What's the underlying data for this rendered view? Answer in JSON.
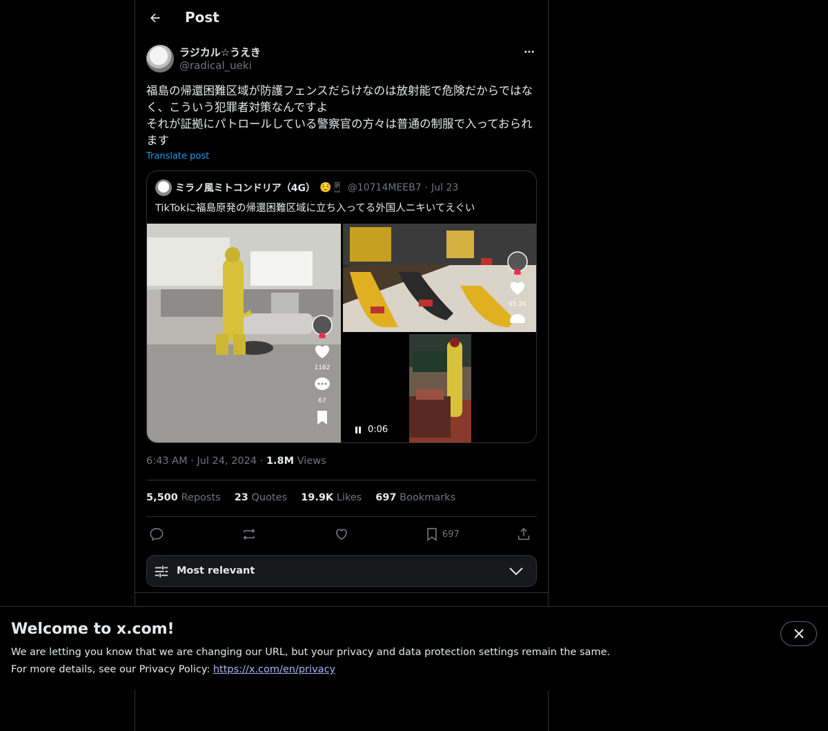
{
  "header": {
    "title": "Post"
  },
  "post": {
    "author_name": "ラジカル☆うえき",
    "author_handle": "@radical_ueki",
    "text": "福島の帰還困難区域が防護フェンスだらけなのは放射能で危険だからではなく、こういう犯罪者対策なんですよ\nそれが証拠にパトロールしている警察官の方々は普通の制服で入っておられます",
    "translate_label": "Translate post",
    "time": "6:43 AM",
    "date": "Jul 24, 2024",
    "views_count": "1.8M",
    "views_label": "Views"
  },
  "quote": {
    "author_name": "ミラノ風ミトコンドリア（4G）",
    "emoji": "☺️📱",
    "handle": "@10714MEEB7",
    "date": "Jul 23",
    "text": "TikTokに福島原発の帰還困難区域に立ち入ってる外国人ニキいてえぐい",
    "media": {
      "video_time": "0:06",
      "likes_1": "1162",
      "comments_1": "67",
      "likes_2": "65.2K"
    }
  },
  "stats": {
    "reposts_count": "5,500",
    "reposts_label": "Reposts",
    "quotes_count": "23",
    "quotes_label": "Quotes",
    "likes_count": "19.9K",
    "likes_label": "Likes",
    "bookmarks_count": "697",
    "bookmarks_label": "Bookmarks"
  },
  "actions": {
    "bookmark_count": "697"
  },
  "sort": {
    "label": "Most relevant"
  },
  "banner": {
    "title": "Welcome to x.com!",
    "line1": "We are letting you know that we are changing our URL, but your privacy and data protection settings remain the same.",
    "line2_prefix": "For more details, see our Privacy Policy: ",
    "link": "https://x.com/en/privacy"
  },
  "colors": {
    "accent": "#1d9bf0",
    "background": "#000000",
    "border": "#2f3336",
    "muted": "#71767b",
    "text": "#e7e9ea"
  }
}
